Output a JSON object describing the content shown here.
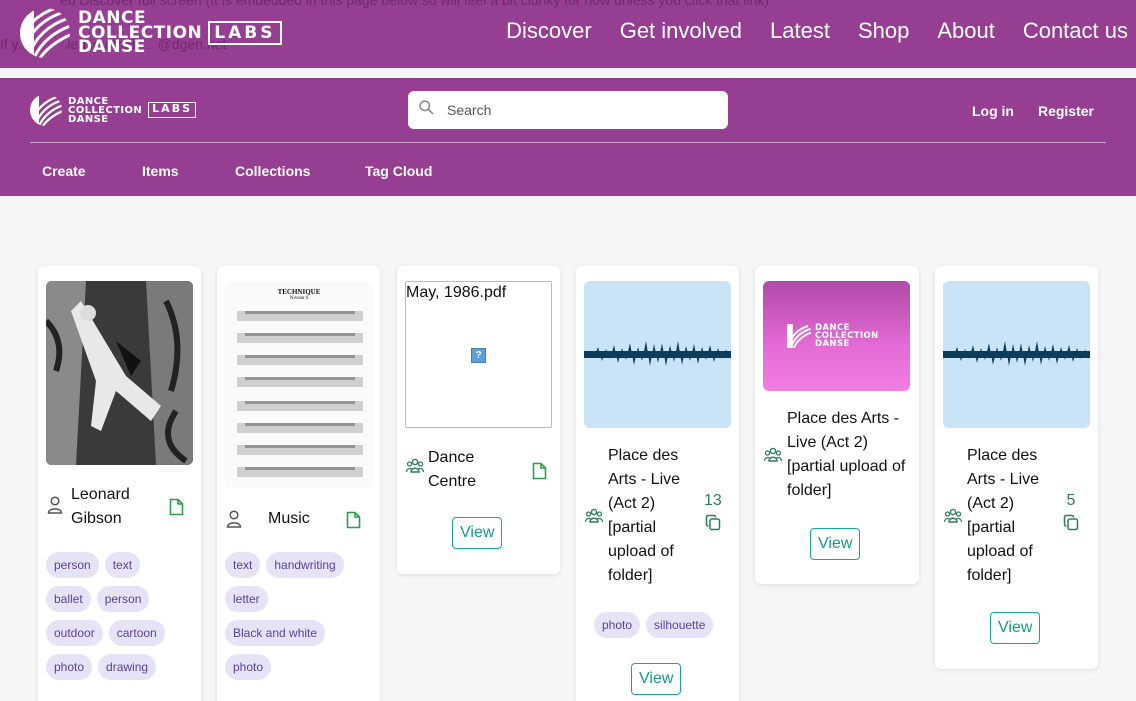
{
  "site": {
    "ghost_line1": "eb Discover full screen (It is embedded in this page below so will feel a bit clunky for now unless you click that link)",
    "ghost_line2": "If y... ...k, please email ... @dgen.net",
    "logo_line1": "DANCE",
    "logo_line2": "COLLECTION",
    "logo_line3": "DANSE",
    "logo_labs": "LABS",
    "nav": [
      "Discover",
      "Get involved",
      "Latest",
      "Shop",
      "About",
      "Contact us"
    ]
  },
  "app": {
    "logo_line1": "DANCE",
    "logo_line2": "COLLECTION",
    "logo_line3": "DANSE",
    "logo_labs": "LABS",
    "search_placeholder": "Search",
    "auth": {
      "login": "Log in",
      "register": "Register"
    },
    "nav": [
      "Create",
      "Items",
      "Collections",
      "Tag Cloud"
    ]
  },
  "colors": {
    "brand": "#963e91",
    "accent": "#139a89",
    "tag_bg": "#e6e3f7",
    "tag_text": "#5a3f9c"
  },
  "cards": [
    {
      "title": "Leonard Gibson",
      "type_icon": "person-icon",
      "file_icon": "document-icon",
      "tags": [
        "person",
        "text",
        "ballet",
        "person",
        "outdoor",
        "cartoon",
        "photo",
        "drawing"
      ]
    },
    {
      "title": "Music",
      "type_icon": "person-icon",
      "file_icon": "document-icon",
      "score_heading": "TECHNIQUE",
      "score_sub": "Niveau 6",
      "tags": [
        "text",
        "handwriting",
        "letter",
        "Black and white",
        "photo"
      ]
    },
    {
      "title": "Dance Centre",
      "type_icon": "group-icon",
      "file_icon": "document-icon",
      "preview_filename": "May, 1986.pdf",
      "view_label": "View"
    },
    {
      "title": "Place des Arts - Live (Act 2) [partial upload of folder]",
      "type_icon": "group-icon",
      "count": "13",
      "count_icon": "copy-icon",
      "tags": [
        "photo",
        "silhouette"
      ],
      "view_label": "View"
    },
    {
      "title": "Place des Arts - Live (Act 2) [partial upload of folder]",
      "type_icon": "group-icon",
      "banner_line1": "DANCE",
      "banner_line2": "COLLECTION",
      "banner_line3": "DANSE",
      "view_label": "View"
    },
    {
      "title": "Place des Arts - Live (Act 2) [partial upload of folder]",
      "type_icon": "group-icon",
      "count": "5",
      "count_icon": "copy-icon",
      "view_label": "View"
    }
  ]
}
